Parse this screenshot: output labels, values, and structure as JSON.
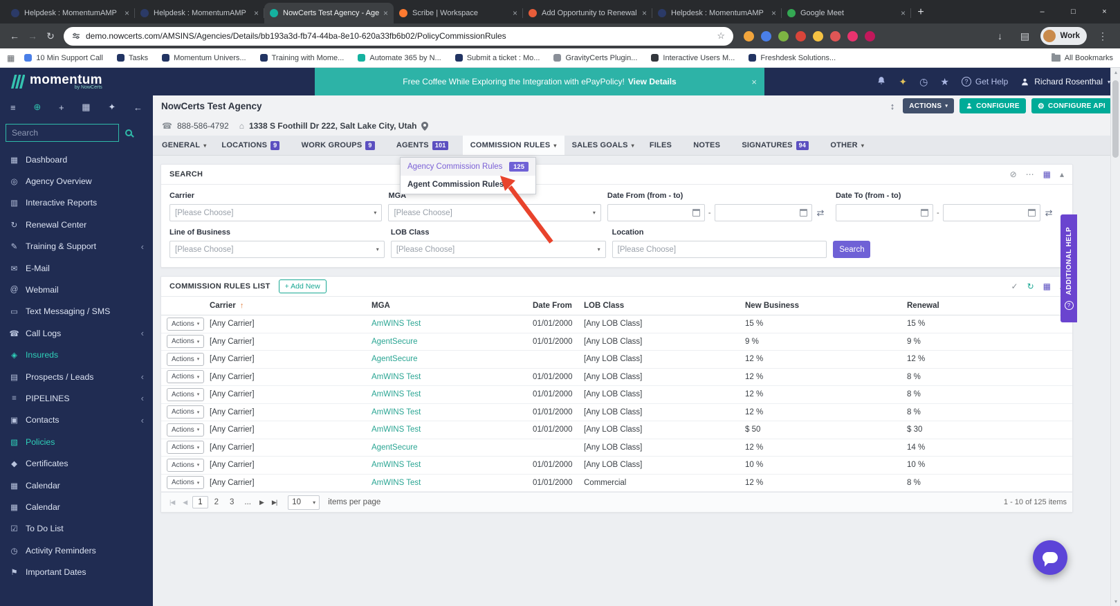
{
  "ui": {
    "caret_down": "▾",
    "collapse_up": "▴",
    "sort_asc": "↑",
    "updown": "↕",
    "check": "✓",
    "refresh": "↻",
    "grid": "▦",
    "disable": "⊘",
    "dots": "⋯",
    "question": "?",
    "chevron_left": "‹",
    "gear": "⚙",
    "scroll_up": "▴",
    "scroll_down": "▾"
  },
  "browser": {
    "tabs": [
      {
        "title": "Helpdesk : MomentumAMP",
        "color": "#2b3a67"
      },
      {
        "title": "Helpdesk : MomentumAMP",
        "color": "#2b3a67"
      },
      {
        "title": "NowCerts Test Agency - Agenc...",
        "color": "#15b2a0",
        "active": true
      },
      {
        "title": "Scribe | Workspace",
        "color": "#ff7a30"
      },
      {
        "title": "Add Opportunity to Renewal O...",
        "color": "#e85d3a"
      },
      {
        "title": "Helpdesk : MomentumAMP",
        "color": "#2b3a67"
      },
      {
        "title": "Google Meet",
        "color": "#34a853"
      }
    ],
    "close_glyph": "×",
    "new_tab_glyph": "+",
    "window_controls": [
      "–",
      "□",
      "×"
    ],
    "toolbar_icons": {
      "back": "←",
      "forward": "→",
      "refresh": "↻",
      "downloads": "↓",
      "side_panel": "▤",
      "menu": "⋮"
    },
    "url": "demo.nowcerts.com/AMSINS/Agencies/Details/bb193a3d-fb74-44ba-8e10-620a33fb6b02/PolicyCommissionRules",
    "star_glyph": "☆",
    "extensions": [
      {
        "color": "#f2a53c"
      },
      {
        "color": "#4a7fe8"
      },
      {
        "color": "#7db443"
      },
      {
        "color": "#d9453a"
      },
      {
        "color": "#f5c243"
      },
      {
        "color": "#e05656"
      },
      {
        "color": "#e8336e"
      },
      {
        "color": "#c2185b"
      }
    ],
    "profile_label": "Work",
    "apps_glyph": "▦",
    "bookmarks": [
      {
        "label": "10 Min Support Call",
        "color": "#4a7fe8"
      },
      {
        "label": "Tasks",
        "color": "#223463"
      },
      {
        "label": "Momentum Univers...",
        "color": "#223463"
      },
      {
        "label": "Training with Mome...",
        "color": "#223463"
      },
      {
        "label": "Automate 365 by N...",
        "color": "#15b2a0"
      },
      {
        "label": "Submit a ticket : Mo...",
        "color": "#223463"
      },
      {
        "label": "GravityCerts Plugin...",
        "color": "#8a8f98"
      },
      {
        "label": "Interactive Users M...",
        "color": "#33373d"
      },
      {
        "label": "Freshdesk Solutions...",
        "color": "#223463"
      }
    ],
    "all_bookmarks_label": "All Bookmarks"
  },
  "header": {
    "logo_text": "momentum",
    "logo_sub": "by NowCerts",
    "banner_text": "Free Coffee While Exploring the Integration with ePayPolicy!",
    "banner_link": "View Details",
    "banner_close": "×",
    "wand_glyph": "✦",
    "clock_glyph": "◷",
    "star_glyph": "★",
    "get_help_label": "Get Help",
    "user_name": "Richard Rosenthal"
  },
  "sidebar": {
    "search_placeholder": "Search",
    "icons_row": [
      {
        "name": "menu",
        "glyph": "≡"
      },
      {
        "name": "globe",
        "glyph": "⊕",
        "teal": true
      },
      {
        "name": "add",
        "glyph": "+"
      },
      {
        "name": "apps",
        "glyph": "▦"
      },
      {
        "name": "magic",
        "glyph": "✦"
      },
      {
        "name": "back",
        "glyph": "←"
      }
    ],
    "items": [
      {
        "label": "Dashboard",
        "glyph": "▦"
      },
      {
        "label": "Agency Overview",
        "glyph": "◎"
      },
      {
        "label": "Interactive Reports",
        "glyph": "▥"
      },
      {
        "label": "Renewal Center",
        "glyph": "↻"
      },
      {
        "label": "Training & Support",
        "glyph": "✎",
        "chevron": true
      },
      {
        "label": "E-Mail",
        "glyph": "✉"
      },
      {
        "label": "Webmail",
        "glyph": "@"
      },
      {
        "label": "Text Messaging / SMS",
        "glyph": "▭"
      },
      {
        "label": "Call Logs",
        "glyph": "☎",
        "chevron": true
      },
      {
        "label": "Insureds",
        "glyph": "◈",
        "active": true
      },
      {
        "label": "Prospects / Leads",
        "glyph": "▤",
        "chevron": true
      },
      {
        "label": "PIPELINES",
        "glyph": "≡",
        "chevron": true
      },
      {
        "label": "Contacts",
        "glyph": "▣",
        "chevron": true
      },
      {
        "label": "Policies",
        "glyph": "▧",
        "active": true
      },
      {
        "label": "Certificates",
        "glyph": "◆"
      },
      {
        "label": "Calendar",
        "glyph": "▦"
      },
      {
        "label": "Calendar",
        "glyph": "▦"
      },
      {
        "label": "To Do List",
        "glyph": "☑"
      },
      {
        "label": "Activity Reminders",
        "glyph": "◷"
      },
      {
        "label": "Important Dates",
        "glyph": "⚑"
      }
    ]
  },
  "page": {
    "title": "NowCerts Test Agency",
    "actions_button": "ACTIONS",
    "configure_button": "CONFIGURE",
    "configure_api_button": "CONFIGURE API",
    "phone": "888-586-4792",
    "phone_glyph": "☎",
    "building_glyph": "⌂",
    "address": "1338 S Foothill Dr 222, Salt Lake City, Utah"
  },
  "nav_tabs": [
    {
      "label": "GENERAL",
      "caret": true
    },
    {
      "label": "LOCATIONS",
      "badge": "9"
    },
    {
      "label": "WORK GROUPS",
      "badge": "9"
    },
    {
      "label": "AGENTS",
      "badge": "101"
    },
    {
      "label": "COMMISSION RULES",
      "caret": true,
      "active": true
    },
    {
      "label": "SALES GOALS",
      "caret": true
    },
    {
      "label": "FILES"
    },
    {
      "label": "NOTES"
    },
    {
      "label": "SIGNATURES",
      "badge": "94"
    },
    {
      "label": "OTHER",
      "caret": true
    }
  ],
  "commission_dropdown": {
    "items": [
      {
        "label": "Agency Commission Rules",
        "badge": "125",
        "primary": true
      },
      {
        "label": "Agent Commission Rules",
        "strong": true
      }
    ]
  },
  "search_panel": {
    "title": "SEARCH",
    "carrier_label": "Carrier",
    "mga_label": "MGA",
    "date_from_label": "Date From (from - to)",
    "date_to_label": "Date To (from - to)",
    "lob_label": "Line of Business",
    "lob_class_label": "LOB Class",
    "location_label": "Location",
    "placeholder": "[Please Choose]",
    "range_separator": "-",
    "swap_glyph": "⇄",
    "search_button": "Search"
  },
  "list_panel": {
    "title": "COMMISSION RULES LIST",
    "add_new_button": "+ Add New",
    "actions_label": "Actions",
    "columns": {
      "carrier": "Carrier",
      "mga": "MGA",
      "date_from": "Date From",
      "lob_class": "LOB Class",
      "new_business": "New Business",
      "renewal": "Renewal"
    },
    "rows": [
      {
        "carrier": "[Any Carrier]",
        "mga": "AmWINS Test",
        "date_from": "01/01/2000",
        "lob_class": "[Any LOB Class]",
        "new_business": "15 %",
        "renewal": "15 %"
      },
      {
        "carrier": "[Any Carrier]",
        "mga": "AgentSecure",
        "date_from": "01/01/2000",
        "lob_class": "[Any LOB Class]",
        "new_business": "9 %",
        "renewal": "9 %"
      },
      {
        "carrier": "[Any Carrier]",
        "mga": "AgentSecure",
        "date_from": "",
        "lob_class": "[Any LOB Class]",
        "new_business": "12 %",
        "renewal": "12 %"
      },
      {
        "carrier": "[Any Carrier]",
        "mga": "AmWINS Test",
        "date_from": "01/01/2000",
        "lob_class": "[Any LOB Class]",
        "new_business": "12 %",
        "renewal": "8 %"
      },
      {
        "carrier": "[Any Carrier]",
        "mga": "AmWINS Test",
        "date_from": "01/01/2000",
        "lob_class": "[Any LOB Class]",
        "new_business": "12 %",
        "renewal": "8 %"
      },
      {
        "carrier": "[Any Carrier]",
        "mga": "AmWINS Test",
        "date_from": "01/01/2000",
        "lob_class": "[Any LOB Class]",
        "new_business": "12 %",
        "renewal": "8 %"
      },
      {
        "carrier": "[Any Carrier]",
        "mga": "AmWINS Test",
        "date_from": "01/01/2000",
        "lob_class": "[Any LOB Class]",
        "new_business": "$ 50",
        "renewal": "$ 30"
      },
      {
        "carrier": "[Any Carrier]",
        "mga": "AgentSecure",
        "date_from": "",
        "lob_class": "[Any LOB Class]",
        "new_business": "12 %",
        "renewal": "14 %"
      },
      {
        "carrier": "[Any Carrier]",
        "mga": "AmWINS Test",
        "date_from": "01/01/2000",
        "lob_class": "[Any LOB Class]",
        "new_business": "10 %",
        "renewal": "10 %"
      },
      {
        "carrier": "[Any Carrier]",
        "mga": "AmWINS Test",
        "date_from": "01/01/2000",
        "lob_class": "Commercial",
        "new_business": "12 %",
        "renewal": "8 %"
      }
    ],
    "pager": {
      "first": "|◀",
      "prev": "◀",
      "next": "▶",
      "last": "▶|",
      "pages": [
        {
          "n": "1",
          "active": true
        },
        {
          "n": "2"
        },
        {
          "n": "3"
        }
      ],
      "ellipsis": "...",
      "page_size": "10",
      "items_per_page": "items per page",
      "summary": "1 - 10 of 125 items"
    }
  },
  "overlays": {
    "additional_help": "ADDITIONAL HELP"
  }
}
